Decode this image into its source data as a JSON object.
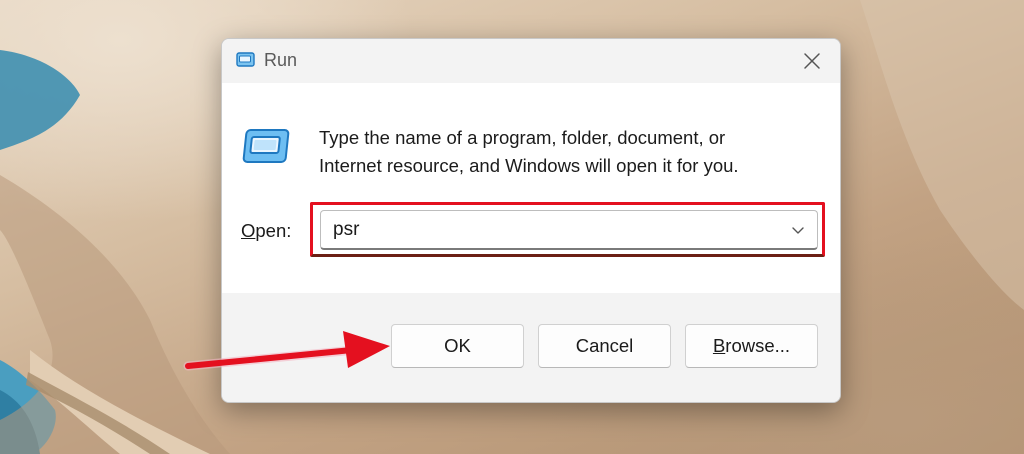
{
  "dialog": {
    "title": "Run",
    "description_line1": "Type the name of a program, folder, document, or",
    "description_line2": "Internet resource, and Windows will open it for you.",
    "open_label_accel": "O",
    "open_label_rest": "pen:",
    "open_value": "psr",
    "buttons": {
      "ok": "OK",
      "cancel": "Cancel",
      "browse_accel": "B",
      "browse_rest": "rowse..."
    }
  },
  "icons": {
    "title": "run-app-icon",
    "big": "run-app-icon",
    "close": "close-icon",
    "dropdown": "chevron-down-icon"
  },
  "annotations": {
    "highlight_color": "#e4101f",
    "arrow_color": "#e4101f"
  },
  "colors": {
    "dialog_bg": "#f3f3f3",
    "content_bg": "#ffffff",
    "icon_blue": "#1e90d8"
  }
}
